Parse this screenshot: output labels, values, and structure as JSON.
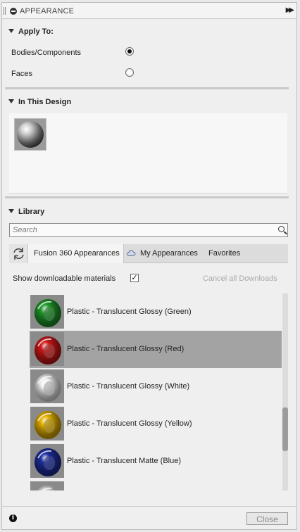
{
  "window": {
    "title": "APPEARANCE"
  },
  "apply_to": {
    "header": "Apply To:",
    "options": [
      {
        "label": "Bodies/Components",
        "selected": true
      },
      {
        "label": "Faces",
        "selected": false
      }
    ]
  },
  "in_design": {
    "header": "In This Design",
    "swatches": [
      {
        "icon": "steel-sphere-icon"
      }
    ]
  },
  "library": {
    "header": "Library",
    "search_placeholder": "Search",
    "tabs": [
      {
        "label": "Fusion 360 Appearances",
        "active": true
      },
      {
        "label": "My Appearances",
        "active": false
      },
      {
        "label": "Favorites",
        "active": false
      }
    ],
    "show_downloadable_label": "Show downloadable materials",
    "show_downloadable_checked": true,
    "cancel_downloads_label": "Cancel all Downloads",
    "items": [
      {
        "label": "Plastic - Translucent Glossy (Green)",
        "color": "#1f9a2a",
        "selected": false
      },
      {
        "label": "Plastic - Translucent Glossy (Red)",
        "color": "#d11818",
        "selected": true
      },
      {
        "label": "Plastic - Translucent Glossy (White)",
        "color": "#f2f2f2",
        "selected": false
      },
      {
        "label": "Plastic - Translucent Glossy (Yellow)",
        "color": "#e6b400",
        "selected": false
      },
      {
        "label": "Plastic - Translucent Matte (Blue)",
        "color": "#1d2fa0",
        "selected": false
      },
      {
        "label": "",
        "color": "#e8e8e8",
        "selected": false
      }
    ],
    "scroll_position": 0.6
  },
  "footer": {
    "close_label": "Close",
    "info_icon": "info-icon"
  },
  "colors": {
    "selection": "#a3a3a3",
    "panel_bg": "#efefef"
  }
}
